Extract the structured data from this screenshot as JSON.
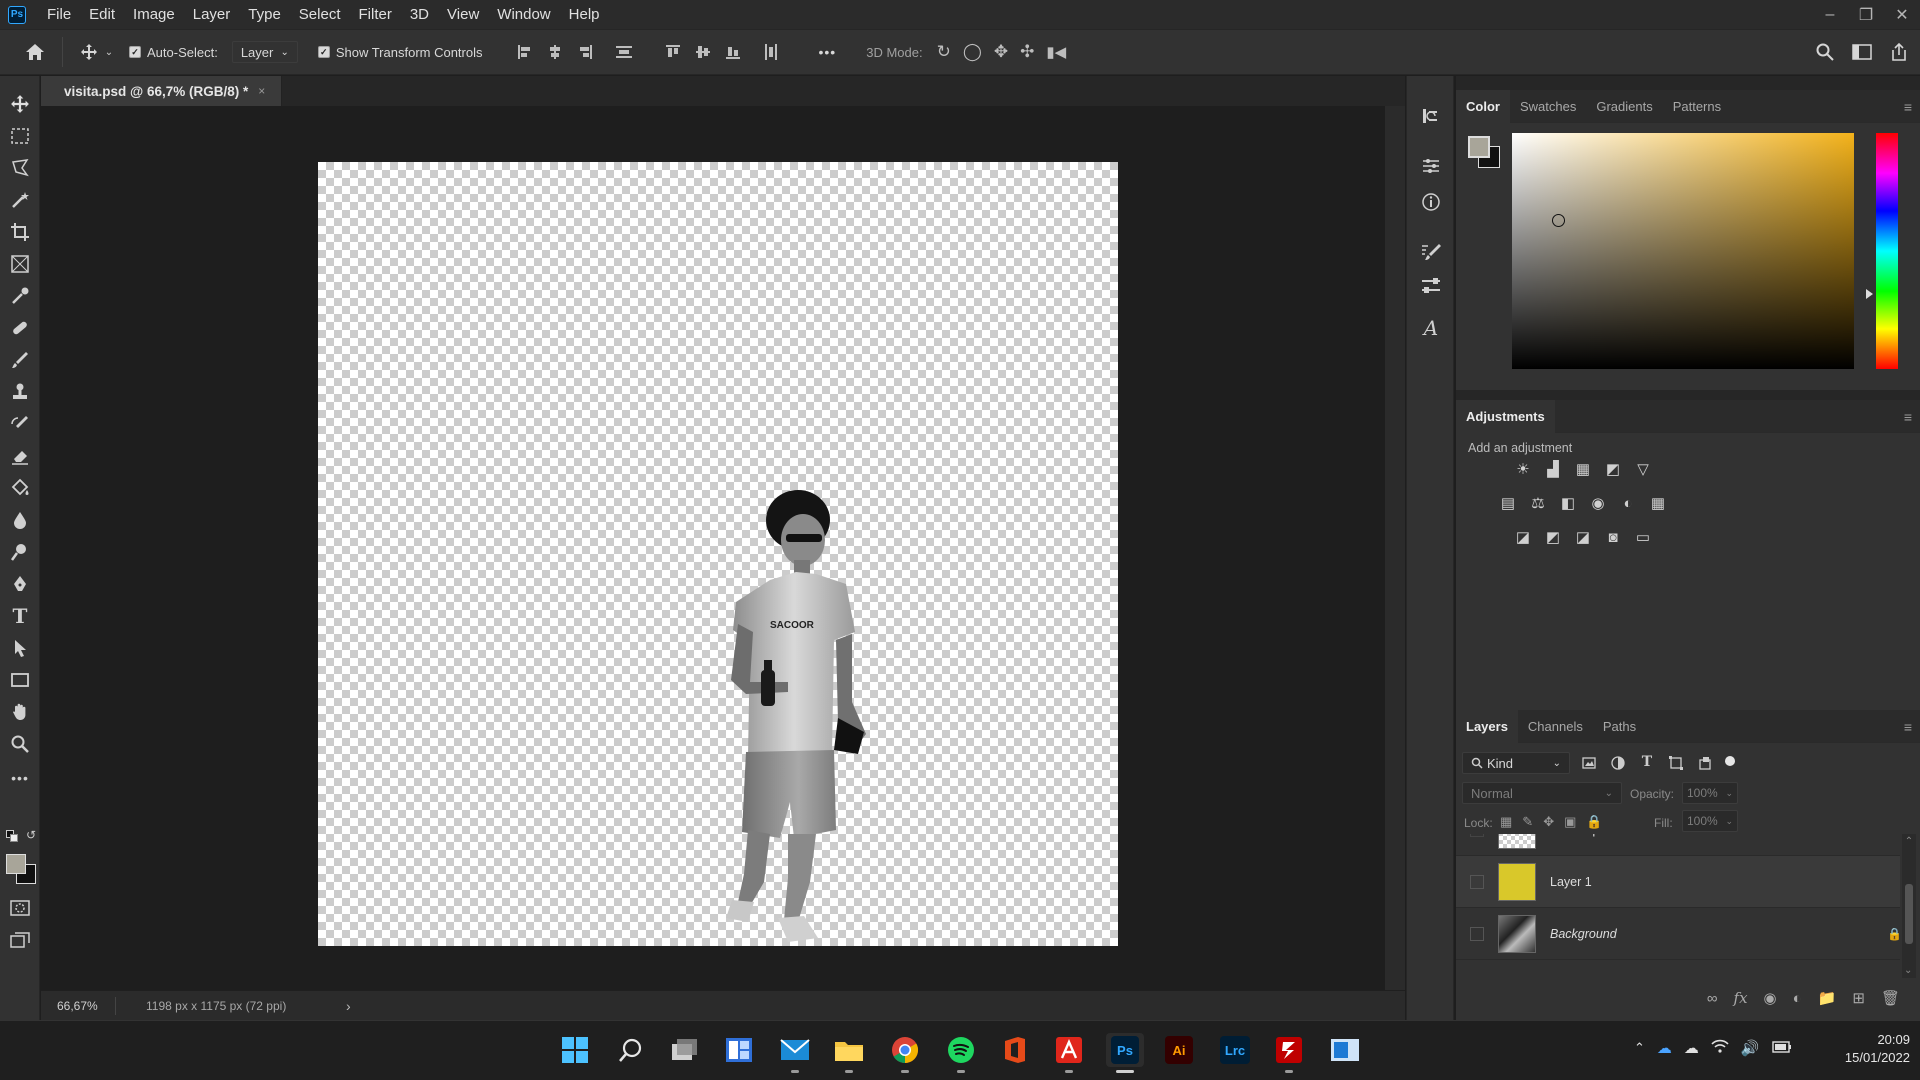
{
  "app": {
    "logo": "Ps"
  },
  "menu": [
    "File",
    "Edit",
    "Image",
    "Layer",
    "Type",
    "Select",
    "Filter",
    "3D",
    "View",
    "Window",
    "Help"
  ],
  "options": {
    "auto_select_label": "Auto-Select:",
    "auto_select_value": "Layer",
    "show_transform_label": "Show Transform Controls",
    "more": "•••",
    "mode_3d_label": "3D Mode:"
  },
  "document": {
    "tab_title": "visita.psd @ 66,7% (RGB/8) *",
    "tab_close": "×",
    "zoom": "66,67%",
    "doc_info": "1198 px x 1175 px (72 ppi)",
    "status_arrow": "›"
  },
  "color_panel": {
    "tabs": [
      "Color",
      "Swatches",
      "Gradients",
      "Patterns"
    ],
    "foreground": "#a8a599",
    "background": "#111111",
    "hue_color": "#f3b21a"
  },
  "adjustments_panel": {
    "tab": "Adjustments",
    "hint": "Add an adjustment",
    "icons_row1": [
      "☀",
      "▟",
      "▦",
      "◩",
      "▽"
    ],
    "icons_row2": [
      "▤",
      "⚖",
      "◧",
      "◉",
      "◐",
      "▦"
    ],
    "icons_row3": [
      "◪",
      "◩",
      "◪",
      "◙",
      "▭"
    ]
  },
  "layers_panel": {
    "tabs": [
      "Layers",
      "Channels",
      "Paths"
    ],
    "filter_kind": "Kind",
    "blend_mode": "Normal",
    "opacity_label": "Opacity:",
    "opacity_value": "100%",
    "lock_label": "Lock:",
    "fill_label": "Fill:",
    "fill_value": "100%",
    "layers": [
      {
        "name": "mannequin",
        "thumb": "checker"
      },
      {
        "name": "Layer 1",
        "thumb": "#d9c82a"
      },
      {
        "name": "Background",
        "thumb": "photo",
        "locked": true
      }
    ],
    "footer_icons": [
      "link-icon",
      "fx-icon",
      "mask-icon",
      "adjustment-icon",
      "folder-icon",
      "new-layer-icon",
      "trash-icon"
    ]
  },
  "taskbar": {
    "time": "20:09",
    "date": "15/01/2022",
    "apps": [
      {
        "name": "start",
        "label": "",
        "color": "#3a8ee6"
      },
      {
        "name": "search",
        "label": "",
        "color": "#1f1f1f"
      },
      {
        "name": "task-view",
        "label": "",
        "color": "#1f1f1f"
      },
      {
        "name": "widgets",
        "label": "",
        "color": "#1f1f1f"
      },
      {
        "name": "mail",
        "label": "",
        "color": "#1f1f1f"
      },
      {
        "name": "explorer",
        "label": "",
        "color": "#1f1f1f"
      },
      {
        "name": "chrome",
        "label": "",
        "color": "#1f1f1f"
      },
      {
        "name": "spotify",
        "label": "",
        "color": "#1f1f1f"
      },
      {
        "name": "office",
        "label": "",
        "color": "#1f1f1f"
      },
      {
        "name": "acrobat",
        "label": "",
        "color": "#1f1f1f"
      },
      {
        "name": "photoshop",
        "label": "Ps",
        "color": "#001e36"
      },
      {
        "name": "illustrator",
        "label": "Ai",
        "color": "#330000"
      },
      {
        "name": "lightroom-classic",
        "label": "Lrc",
        "color": "#001d34"
      },
      {
        "name": "filezilla",
        "label": "",
        "color": "#1f1f1f"
      },
      {
        "name": "remote-desktop",
        "label": "",
        "color": "#1f1f1f"
      }
    ]
  }
}
